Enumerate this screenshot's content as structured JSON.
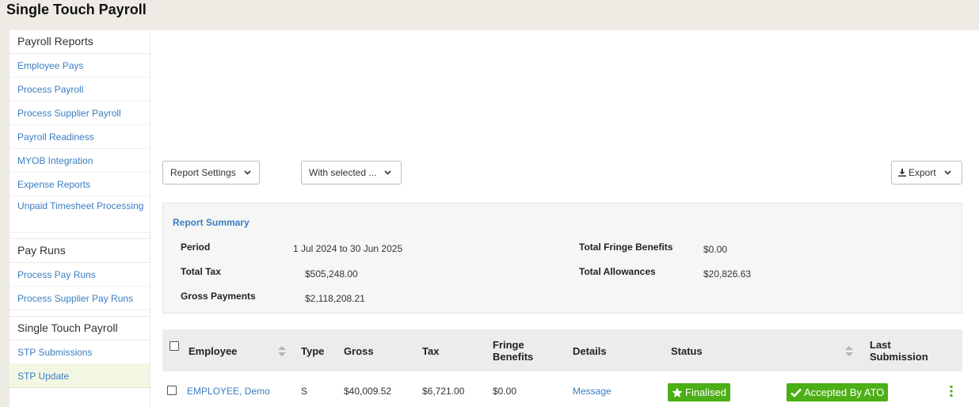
{
  "page": {
    "title": "Single Touch Payroll"
  },
  "sidebar": {
    "sections": [
      {
        "heading": "Payroll Reports",
        "items": [
          "Employee Pays",
          "Process Payroll",
          "Process Supplier Payroll",
          "Payroll Readiness",
          "MYOB Integration",
          "Expense Reports",
          "Unpaid Timesheet Processing"
        ]
      },
      {
        "heading": "Pay Runs",
        "items": [
          "Process Pay Runs",
          "Process Supplier Pay Runs"
        ]
      },
      {
        "heading": "Single Touch Payroll",
        "items": [
          "STP Submissions",
          "STP Update"
        ]
      }
    ],
    "active_item": "STP Update"
  },
  "toolbar": {
    "report_settings_label": "Report Settings",
    "with_selected_label": "With selected ...",
    "export_label": "Export"
  },
  "summary": {
    "title": "Report Summary",
    "period_label": "Period",
    "period_value": "1 Jul 2024 to 30 Jun 2025",
    "total_tax_label": "Total Tax",
    "total_tax_value": "$505,248.00",
    "gross_payments_label": "Gross Payments",
    "gross_payments_value": "$2,118,208.21",
    "fringe_label": "Total Fringe Benefits",
    "fringe_value": "$0.00",
    "allowances_label": "Total Allowances",
    "allowances_value": "$20,826.63"
  },
  "table": {
    "headers": {
      "employee": "Employee",
      "type": "Type",
      "gross": "Gross",
      "tax": "Tax",
      "fringe_line1": "Fringe",
      "fringe_line2": "Benefits",
      "details": "Details",
      "status": "Status",
      "last_line1": "Last",
      "last_line2": "Submission"
    },
    "rows": [
      {
        "employee": "EMPLOYEE, Demo",
        "type": "S",
        "gross": "$40,009.52",
        "tax": "$6,721.00",
        "fringe": "$0.00",
        "details": "Message",
        "status": "Finalised",
        "last_submission": "Accepted By ATO"
      }
    ]
  },
  "colors": {
    "link": "#3a7ec2",
    "badge_green": "#4caf15",
    "active_sidebar_bg": "#f2f7e4",
    "kebab_green": "#4caf15"
  },
  "icons": [
    "chevron-down-icon",
    "download-icon",
    "sort-icon",
    "star-icon",
    "check-icon",
    "kebab-menu-icon"
  ]
}
